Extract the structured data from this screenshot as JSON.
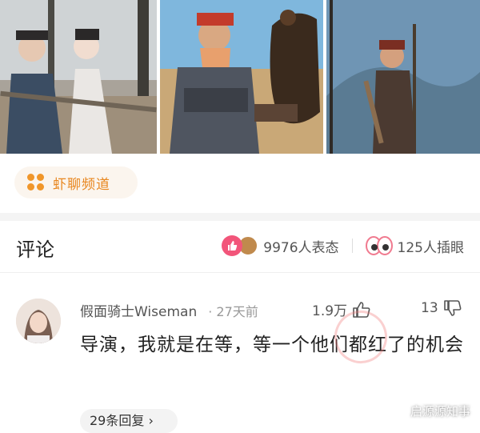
{
  "channel": {
    "label": "虾聊频道",
    "icon": "flower-icon",
    "accent": "#e8861e"
  },
  "header": {
    "title": "评论",
    "reactions_text": "9976人表态",
    "eyes_text": "125人插眼",
    "like_color": "#f2557a"
  },
  "comment": {
    "username": "假面骑士Wiseman",
    "time": "· 27天前",
    "likes": "1.9万",
    "dislikes": "13",
    "text": "导演，我就是在等，等一个他们都红了的机会",
    "replies": "29条回复 ›"
  },
  "watermark": "启源源知事"
}
